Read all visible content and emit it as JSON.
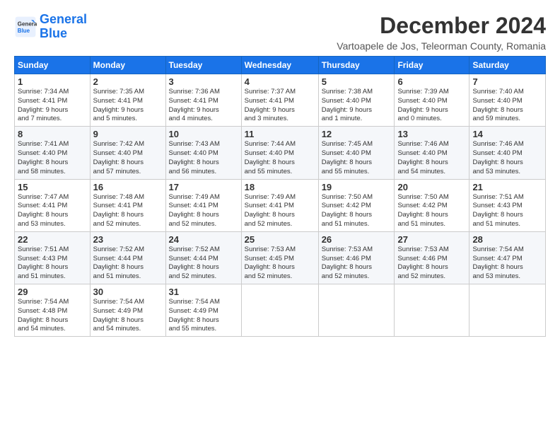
{
  "logo": {
    "line1": "General",
    "line2": "Blue"
  },
  "title": "December 2024",
  "subtitle": "Vartoapele de Jos, Teleorman County, Romania",
  "headers": [
    "Sunday",
    "Monday",
    "Tuesday",
    "Wednesday",
    "Thursday",
    "Friday",
    "Saturday"
  ],
  "weeks": [
    [
      {
        "day": "1",
        "info": "Sunrise: 7:34 AM\nSunset: 4:41 PM\nDaylight: 9 hours\nand 7 minutes."
      },
      {
        "day": "2",
        "info": "Sunrise: 7:35 AM\nSunset: 4:41 PM\nDaylight: 9 hours\nand 5 minutes."
      },
      {
        "day": "3",
        "info": "Sunrise: 7:36 AM\nSunset: 4:41 PM\nDaylight: 9 hours\nand 4 minutes."
      },
      {
        "day": "4",
        "info": "Sunrise: 7:37 AM\nSunset: 4:41 PM\nDaylight: 9 hours\nand 3 minutes."
      },
      {
        "day": "5",
        "info": "Sunrise: 7:38 AM\nSunset: 4:40 PM\nDaylight: 9 hours\nand 1 minute."
      },
      {
        "day": "6",
        "info": "Sunrise: 7:39 AM\nSunset: 4:40 PM\nDaylight: 9 hours\nand 0 minutes."
      },
      {
        "day": "7",
        "info": "Sunrise: 7:40 AM\nSunset: 4:40 PM\nDaylight: 8 hours\nand 59 minutes."
      }
    ],
    [
      {
        "day": "8",
        "info": "Sunrise: 7:41 AM\nSunset: 4:40 PM\nDaylight: 8 hours\nand 58 minutes."
      },
      {
        "day": "9",
        "info": "Sunrise: 7:42 AM\nSunset: 4:40 PM\nDaylight: 8 hours\nand 57 minutes."
      },
      {
        "day": "10",
        "info": "Sunrise: 7:43 AM\nSunset: 4:40 PM\nDaylight: 8 hours\nand 56 minutes."
      },
      {
        "day": "11",
        "info": "Sunrise: 7:44 AM\nSunset: 4:40 PM\nDaylight: 8 hours\nand 55 minutes."
      },
      {
        "day": "12",
        "info": "Sunrise: 7:45 AM\nSunset: 4:40 PM\nDaylight: 8 hours\nand 55 minutes."
      },
      {
        "day": "13",
        "info": "Sunrise: 7:46 AM\nSunset: 4:40 PM\nDaylight: 8 hours\nand 54 minutes."
      },
      {
        "day": "14",
        "info": "Sunrise: 7:46 AM\nSunset: 4:40 PM\nDaylight: 8 hours\nand 53 minutes."
      }
    ],
    [
      {
        "day": "15",
        "info": "Sunrise: 7:47 AM\nSunset: 4:41 PM\nDaylight: 8 hours\nand 53 minutes."
      },
      {
        "day": "16",
        "info": "Sunrise: 7:48 AM\nSunset: 4:41 PM\nDaylight: 8 hours\nand 52 minutes."
      },
      {
        "day": "17",
        "info": "Sunrise: 7:49 AM\nSunset: 4:41 PM\nDaylight: 8 hours\nand 52 minutes."
      },
      {
        "day": "18",
        "info": "Sunrise: 7:49 AM\nSunset: 4:41 PM\nDaylight: 8 hours\nand 52 minutes."
      },
      {
        "day": "19",
        "info": "Sunrise: 7:50 AM\nSunset: 4:42 PM\nDaylight: 8 hours\nand 51 minutes."
      },
      {
        "day": "20",
        "info": "Sunrise: 7:50 AM\nSunset: 4:42 PM\nDaylight: 8 hours\nand 51 minutes."
      },
      {
        "day": "21",
        "info": "Sunrise: 7:51 AM\nSunset: 4:43 PM\nDaylight: 8 hours\nand 51 minutes."
      }
    ],
    [
      {
        "day": "22",
        "info": "Sunrise: 7:51 AM\nSunset: 4:43 PM\nDaylight: 8 hours\nand 51 minutes."
      },
      {
        "day": "23",
        "info": "Sunrise: 7:52 AM\nSunset: 4:44 PM\nDaylight: 8 hours\nand 51 minutes."
      },
      {
        "day": "24",
        "info": "Sunrise: 7:52 AM\nSunset: 4:44 PM\nDaylight: 8 hours\nand 52 minutes."
      },
      {
        "day": "25",
        "info": "Sunrise: 7:53 AM\nSunset: 4:45 PM\nDaylight: 8 hours\nand 52 minutes."
      },
      {
        "day": "26",
        "info": "Sunrise: 7:53 AM\nSunset: 4:46 PM\nDaylight: 8 hours\nand 52 minutes."
      },
      {
        "day": "27",
        "info": "Sunrise: 7:53 AM\nSunset: 4:46 PM\nDaylight: 8 hours\nand 52 minutes."
      },
      {
        "day": "28",
        "info": "Sunrise: 7:54 AM\nSunset: 4:47 PM\nDaylight: 8 hours\nand 53 minutes."
      }
    ],
    [
      {
        "day": "29",
        "info": "Sunrise: 7:54 AM\nSunset: 4:48 PM\nDaylight: 8 hours\nand 54 minutes."
      },
      {
        "day": "30",
        "info": "Sunrise: 7:54 AM\nSunset: 4:49 PM\nDaylight: 8 hours\nand 54 minutes."
      },
      {
        "day": "31",
        "info": "Sunrise: 7:54 AM\nSunset: 4:49 PM\nDaylight: 8 hours\nand 55 minutes."
      },
      {
        "day": "",
        "info": ""
      },
      {
        "day": "",
        "info": ""
      },
      {
        "day": "",
        "info": ""
      },
      {
        "day": "",
        "info": ""
      }
    ]
  ]
}
